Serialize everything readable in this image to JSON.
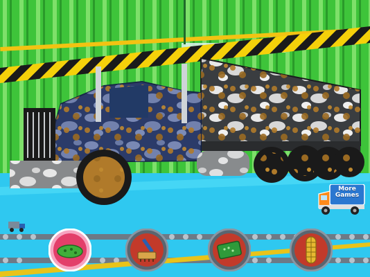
{
  "game": {
    "scene": "truck-wash",
    "colors": {
      "wall_green": "#3ec43a",
      "wall_stripe_light": "#7ee06a",
      "hazard_yellow": "#f5d10a",
      "hazard_black": "#1a1a1a",
      "floor_cyan": "#2fc8f0",
      "truck_cab_blue": "#1e3a8a",
      "truck_dumper_gray": "#3a3d40",
      "mud_brown": "#b07a2a"
    }
  },
  "more_games": {
    "line1": "More",
    "line2": "Games",
    "icon": "delivery-truck-icon"
  },
  "toolbar": {
    "tools": [
      {
        "icon": "green-sponge-icon",
        "selected": true
      },
      {
        "icon": "scrub-brush-icon",
        "selected": false
      },
      {
        "icon": "green-soap-bar-icon",
        "selected": false
      },
      {
        "icon": "corncob-brush-icon",
        "selected": false
      }
    ]
  }
}
